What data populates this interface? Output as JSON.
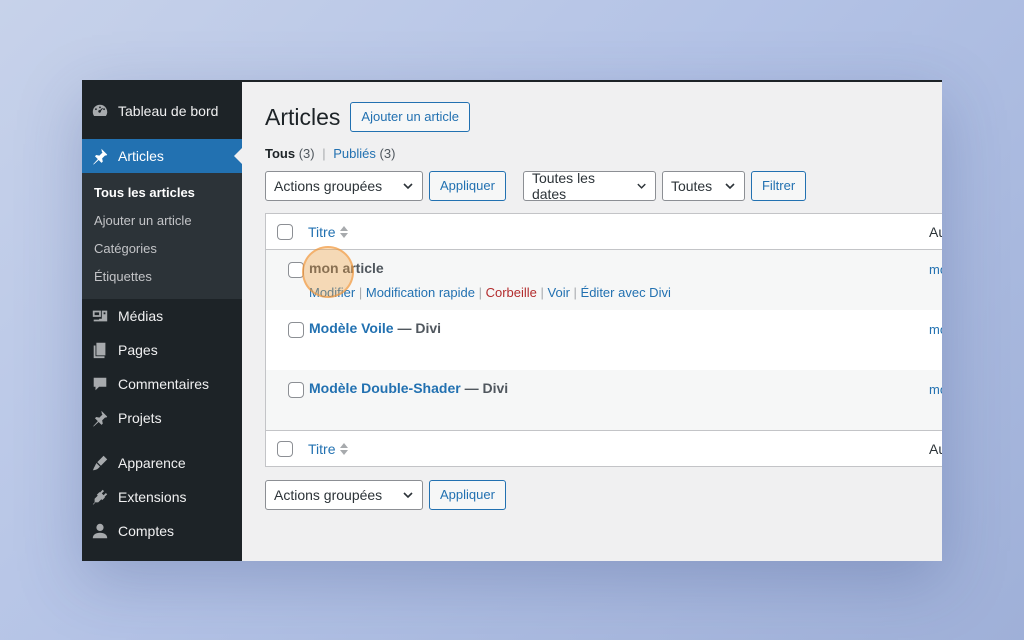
{
  "sidebar": {
    "items_top": [
      {
        "label": "Tableau de bord",
        "icon": "dashboard-icon"
      },
      {
        "label": "Articles",
        "icon": "pin-icon",
        "active": true
      }
    ],
    "submenu": [
      {
        "label": "Tous les articles",
        "current": true
      },
      {
        "label": "Ajouter un article"
      },
      {
        "label": "Catégories"
      },
      {
        "label": "Étiquettes"
      }
    ],
    "items_bottom": [
      {
        "label": "Médias",
        "icon": "media-icon"
      },
      {
        "label": "Pages",
        "icon": "pages-icon"
      },
      {
        "label": "Commentaires",
        "icon": "comments-icon"
      },
      {
        "label": "Projets",
        "icon": "pin-icon"
      },
      {
        "label": "Apparence",
        "icon": "brush-icon"
      },
      {
        "label": "Extensions",
        "icon": "plugin-icon"
      },
      {
        "label": "Comptes",
        "icon": "user-icon"
      }
    ]
  },
  "header": {
    "title": "Articles",
    "add_button": "Ajouter un article"
  },
  "filters_links": {
    "all_label": "Tous",
    "all_count": "(3)",
    "separator": "|",
    "published_label": "Publiés",
    "published_count": "(3)"
  },
  "tablenav_top": {
    "bulk_select": "Actions groupées",
    "apply_button": "Appliquer",
    "dates_select": "Toutes les dates",
    "category_select": "Toutes",
    "filter_button": "Filtrer"
  },
  "table": {
    "col_title": "Titre",
    "col_author_partial": "Au",
    "rows": [
      {
        "title": "mon article",
        "state": "",
        "author_partial": "mo",
        "actions": [
          "Modifier",
          "Modification rapide",
          "Corbeille",
          "Voir",
          "Éditer avec Divi"
        ]
      },
      {
        "title": "Modèle Voile",
        "state": "— Divi",
        "author_partial": "mo"
      },
      {
        "title": "Modèle Double-Shader",
        "state": "— Divi",
        "author_partial": "mo"
      }
    ]
  },
  "tablenav_bottom": {
    "bulk_select": "Actions groupées",
    "apply_button": "Appliquer"
  },
  "colors": {
    "sidebar_bg": "#1d2327",
    "accent": "#2271b1",
    "trash": "#b32d2e",
    "highlight": "#f4a03c"
  }
}
